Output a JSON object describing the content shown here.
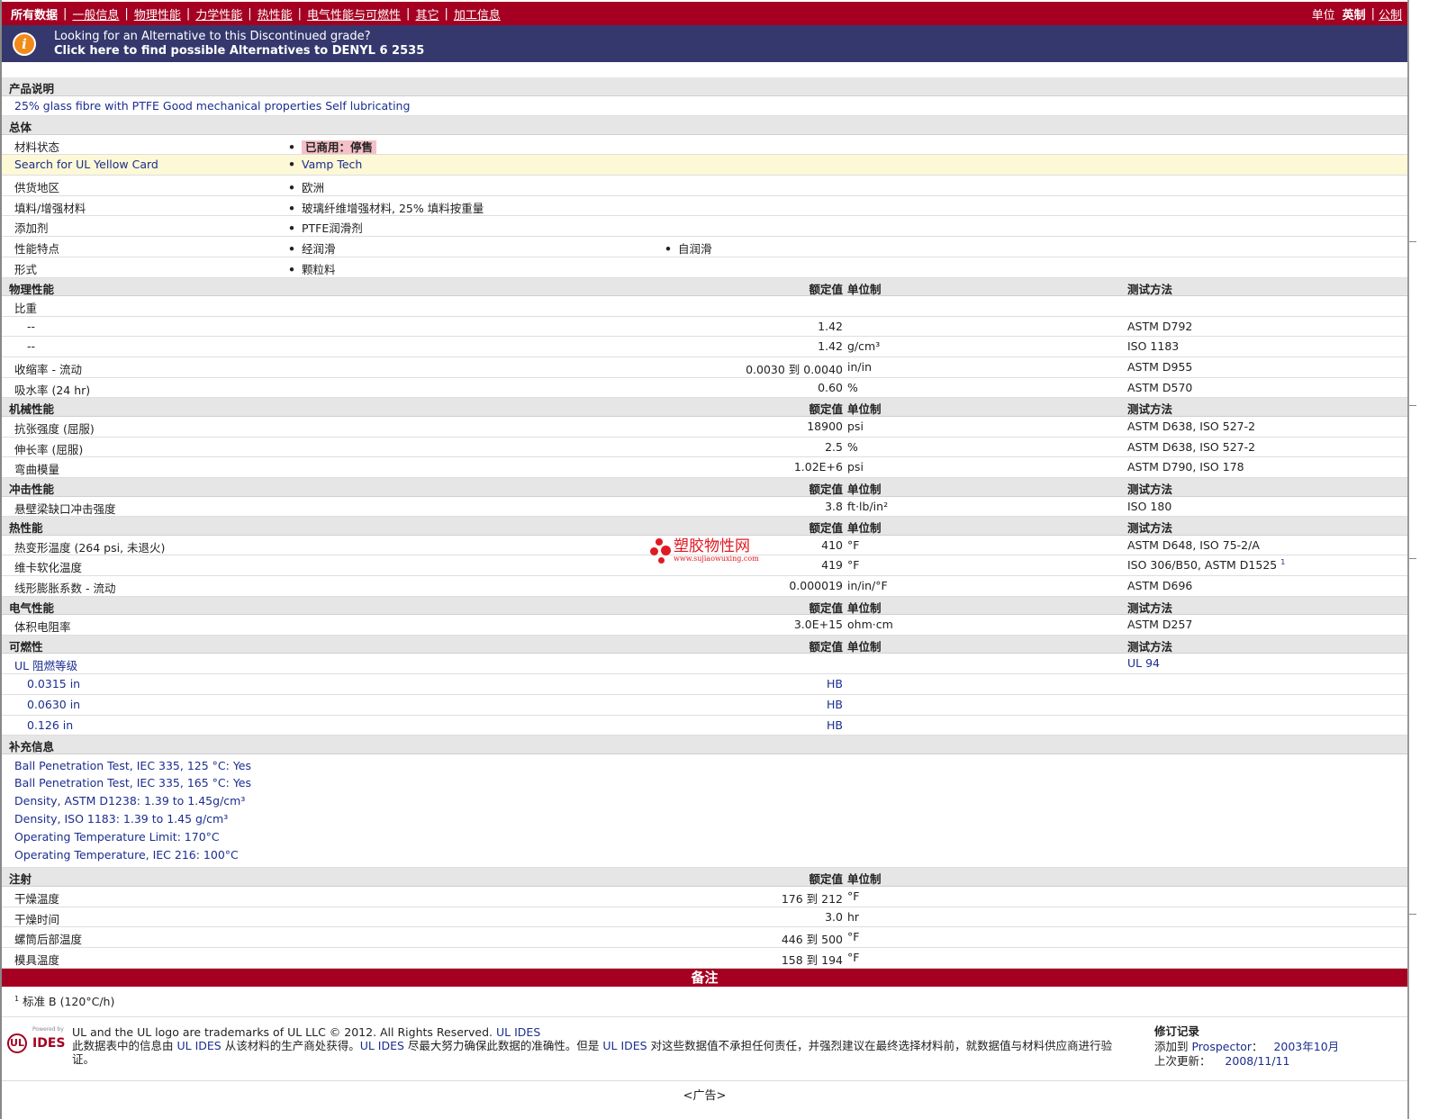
{
  "nav": {
    "items": [
      "所有数据",
      "一般信息",
      "物理性能",
      "力学性能",
      "热性能",
      "电气性能与可燃性",
      "其它",
      "加工信息"
    ],
    "units_label": "单位",
    "units_current": "英制",
    "units_alt": "公制"
  },
  "banner": {
    "line1": "Looking for an Alternative to this Discontinued grade?",
    "line2": "Click here to find possible Alternatives to DENYL 6 2535"
  },
  "table_headers": {
    "value": "额定值",
    "unit": "单位制",
    "test": "测试方法"
  },
  "description": {
    "title": "产品说明",
    "text": "25% glass fibre with PTFE Good mechanical properties Self lubricating"
  },
  "general": {
    "title": "总体",
    "rows": [
      {
        "label": "材料状态",
        "values": [
          "已商用：停售"
        ]
      },
      {
        "label": "Search for UL Yellow Card",
        "values": [
          "Vamp Tech"
        ]
      },
      {
        "label": "供货地区",
        "values": [
          "欧洲"
        ]
      },
      {
        "label": "填料/增强材料",
        "values": [
          "玻璃纤维增强材料, 25% 填料按重量"
        ]
      },
      {
        "label": "添加剂",
        "values": [
          "PTFE润滑剂"
        ]
      },
      {
        "label": "性能特点",
        "values": [
          "经润滑",
          "自润滑"
        ]
      },
      {
        "label": "形式",
        "values": [
          "颗粒料"
        ]
      }
    ]
  },
  "physical": {
    "title": "物理性能",
    "rows": [
      {
        "label": "比重",
        "value": "",
        "unit": "",
        "test": ""
      },
      {
        "label": "--",
        "value": "1.42",
        "unit": "",
        "test": "ASTM D792"
      },
      {
        "label": "--",
        "value": "1.42",
        "unit": "g/cm³",
        "test": "ISO 1183"
      },
      {
        "label": "收缩率 - 流动",
        "value": "0.0030 到  0.0040",
        "unit": "in/in",
        "test": "ASTM D955"
      },
      {
        "label": "吸水率 (24 hr)",
        "value": "0.60",
        "unit": "%",
        "test": "ASTM D570"
      }
    ]
  },
  "mechanical": {
    "title": "机械性能",
    "rows": [
      {
        "label": "抗张强度 (屈服)",
        "value": "18900",
        "unit": "psi",
        "test": "ASTM D638, ISO 527-2"
      },
      {
        "label": "伸长率 (屈服)",
        "value": "2.5",
        "unit": "%",
        "test": "ASTM D638, ISO 527-2"
      },
      {
        "label": "弯曲模量",
        "value": "1.02E+6",
        "unit": "psi",
        "test": "ASTM D790, ISO 178"
      }
    ]
  },
  "impact": {
    "title": "冲击性能",
    "rows": [
      {
        "label": "悬壁梁缺口冲击强度",
        "value": "3.8",
        "unit": "ft·lb/in²",
        "test": "ISO 180"
      }
    ]
  },
  "thermal": {
    "title": "热性能",
    "rows": [
      {
        "label": "热变形温度 (264 psi, 未退火)",
        "value": "410",
        "unit": "°F",
        "test": "ASTM D648, ISO 75-2/A"
      },
      {
        "label": "维卡软化温度",
        "value": "419",
        "unit": "°F",
        "test": "ISO 306/B50, ASTM D1525",
        "sup": "1"
      },
      {
        "label": "线形膨胀系数 - 流动",
        "value": "0.000019",
        "unit": "in/in/°F",
        "test": "ASTM D696"
      }
    ]
  },
  "electrical": {
    "title": "电气性能",
    "rows": [
      {
        "label": "体积电阻率",
        "value": "3.0E+15",
        "unit": "ohm·cm",
        "test": "ASTM D257"
      }
    ]
  },
  "flammability": {
    "title": "可燃性",
    "rows": [
      {
        "label": "UL 阻燃等级",
        "value": "",
        "unit": "",
        "test": "UL 94"
      },
      {
        "label": "0.0315 in",
        "value": "HB",
        "unit": "",
        "test": ""
      },
      {
        "label": "0.0630 in",
        "value": "HB",
        "unit": "",
        "test": ""
      },
      {
        "label": "0.126 in",
        "value": "HB",
        "unit": "",
        "test": ""
      }
    ]
  },
  "supplemental": {
    "title": "补充信息",
    "lines": [
      "Ball Penetration Test, IEC 335, 125 °C: Yes",
      "Ball Penetration Test, IEC 335, 165 °C: Yes",
      "Density, ASTM D1238: 1.39 to 1.45g/cm³",
      "Density, ISO 1183: 1.39 to 1.45 g/cm³",
      "Operating Temperature Limit: 170°C",
      "Operating Temperature, IEC 216: 100°C"
    ]
  },
  "injection": {
    "title": "注射",
    "rows": [
      {
        "label": "干燥温度",
        "value": "176 到  212",
        "unit": "°F"
      },
      {
        "label": "干燥时间",
        "value": "3.0",
        "unit": "hr"
      },
      {
        "label": "螺筒后部温度",
        "value": "446 到  500",
        "unit": "°F"
      },
      {
        "label": "模具温度",
        "value": "158 到  194",
        "unit": "°F"
      }
    ]
  },
  "notes": {
    "title": "备注",
    "sup": "1",
    "text": "标准 B (120°C/h)"
  },
  "watermark": {
    "text": "塑胶物性网",
    "url": "www.sujiaowuxing.com"
  },
  "footer": {
    "powered": "Powered by",
    "logo_ul": "UL",
    "logo_ides": "IDES",
    "line1": "UL and the UL logo are trademarks of UL LLC © 2012. All Rights Reserved.",
    "line1_link": "UL IDES",
    "line2_a": "此数据表中的信息由 ",
    "line2_b": "UL IDES",
    "line2_c": " 从该材料的生产商处获得。",
    "line2_d": "UL IDES",
    "line2_e": " 尽最大努力确保此数据的准确性。但是 ",
    "line2_f": "UL IDES",
    "line2_g": " 对这些数据值不承担任何责任，并强烈建议在最终选择材料前，就数据值与材料供应商进行验证。",
    "revision_title": "修订记录",
    "added_label": "添加到 ",
    "added_prospector": "Prospector",
    "added_sep": "：",
    "added_value": "2003年10月",
    "updated_label": "上次更新：",
    "updated_value": "2008/11/11",
    "ad": "<广告>"
  }
}
